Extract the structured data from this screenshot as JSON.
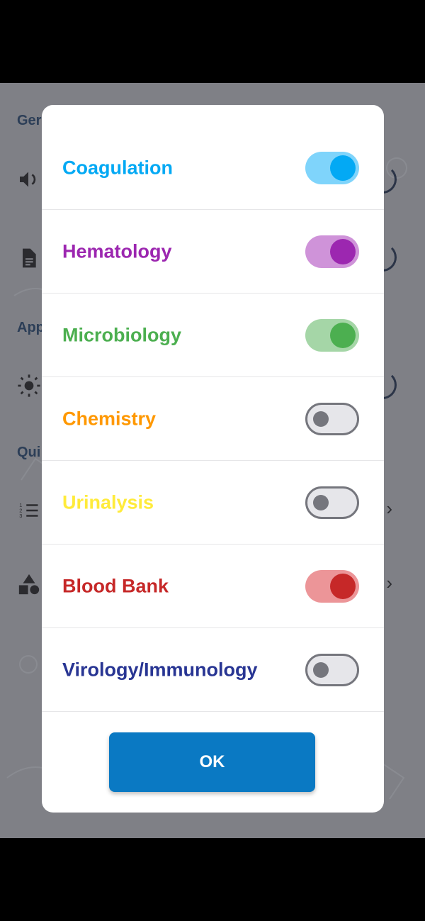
{
  "background": {
    "sections": [
      "Ger",
      "App",
      "Qui"
    ]
  },
  "dialog": {
    "items": [
      {
        "label": "Coagulation",
        "color": "#03a9f4",
        "on": true,
        "track": "#7fd4fb"
      },
      {
        "label": "Hematology",
        "color": "#9c27b0",
        "on": true,
        "track": "#cf93d9"
      },
      {
        "label": "Microbiology",
        "color": "#4caf50",
        "on": true,
        "track": "#a5d6a7"
      },
      {
        "label": "Chemistry",
        "color": "#ff9800",
        "on": false,
        "track": "#e6e6ea"
      },
      {
        "label": "Urinalysis",
        "color": "#ffeb3b",
        "on": false,
        "track": "#e6e6ea"
      },
      {
        "label": "Blood Bank",
        "color": "#c62828",
        "on": true,
        "track": "#ec9598"
      },
      {
        "label": "Virology/Immunology",
        "color": "#283593",
        "on": false,
        "track": "#e6e6ea"
      }
    ],
    "ok_label": "OK"
  }
}
